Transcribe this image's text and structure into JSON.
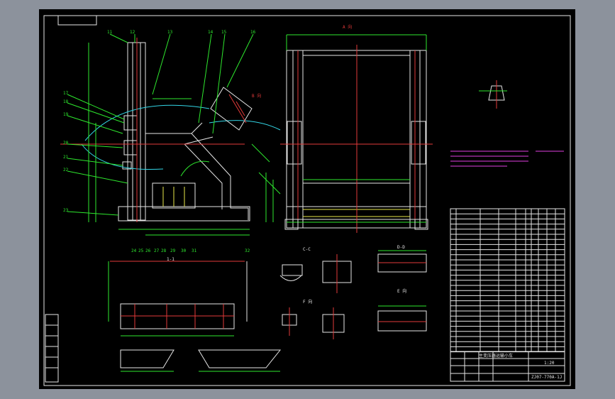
{
  "colors": {
    "background_outer": "#8c929c",
    "sheet": "#000000",
    "outline": "#e6e6e6",
    "dimension": "#2ee82e",
    "centerline": "#e23a3a",
    "hidden": "#e8e84a",
    "note": "#e040e0",
    "curve": "#33d6e6"
  },
  "views": {
    "main_view_label": "1-1",
    "front_view_label": "A 向",
    "section_b_label": "B 向",
    "section_c_label": "C-C",
    "section_d_label": "D-D",
    "section_e_label": "E 向",
    "detail_label": "F 向",
    "plan_label": "1-1"
  },
  "main_view_callouts": [
    "11",
    "12",
    "13",
    "14",
    "15",
    "16",
    "17",
    "18",
    "19",
    "20",
    "21",
    "22",
    "23",
    "24",
    "25",
    "26",
    "27",
    "28",
    "29",
    "30",
    "31",
    "32"
  ],
  "title_block": {
    "drawing_number": "ZJ07-770A-1J",
    "title": "主变压器运输小车",
    "scale": "1:20"
  },
  "parts_list_rows": 28
}
